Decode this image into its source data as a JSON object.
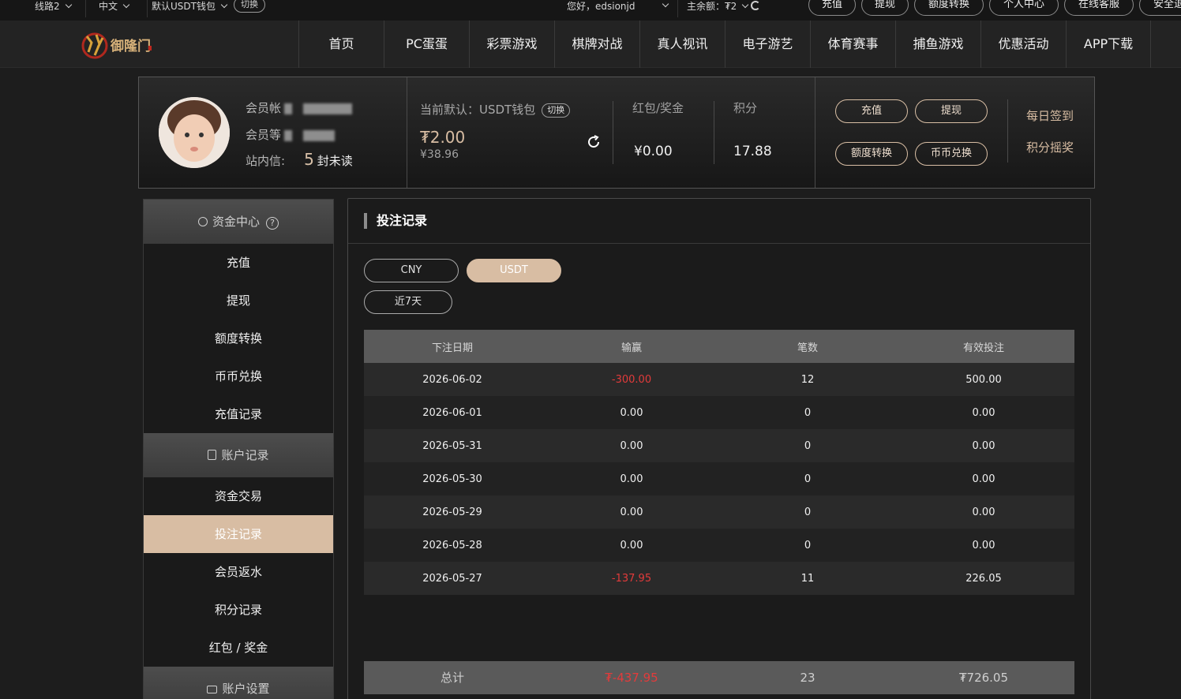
{
  "topbar": {
    "line_select": "线路2",
    "lang_select": "中文",
    "wallet_select": "默认USDT钱包",
    "switch_label": "切换",
    "greeting": "您好，edsionjd",
    "balance_label": "主余额：₮2",
    "buttons": [
      "充值",
      "提现",
      "额度转换",
      "个人中心",
      "在线客服",
      "安全退出"
    ]
  },
  "nav": {
    "items": [
      "首页",
      "PC蛋蛋",
      "彩票游戏",
      "棋牌对战",
      "真人视讯",
      "电子游艺",
      "体育赛事",
      "捕鱼游戏",
      "优惠活动",
      "APP下载"
    ]
  },
  "account": {
    "member_account_label": "会员帐",
    "member_level_label": "会员等",
    "inbox_label": "站内信:",
    "unread_count": "5",
    "unread_label": "封未读",
    "default_wallet": "当前默认：USDT钱包",
    "switch_label": "切换",
    "balance_usdt": "₮2.00",
    "balance_cny": "¥38.96",
    "bonus_label": "红包/奖金",
    "bonus_value": "¥0.00",
    "points_label": "积分",
    "points_value": "17.88",
    "btn_deposit": "充值",
    "btn_withdraw": "提现",
    "btn_transfer": "额度转换",
    "btn_exchange": "币币兑换",
    "daily_signin": "每日签到",
    "points_lottery": "积分摇奖"
  },
  "sidebar": {
    "fund_center": "资金中心",
    "fund_items": [
      "充值",
      "提现",
      "额度转换",
      "币币兑换",
      "充值记录"
    ],
    "account_records": "账户记录",
    "record_items": [
      "资金交易",
      "投注记录",
      "会员返水",
      "积分记录",
      "红包 / 奖金"
    ],
    "account_settings": "账户设置"
  },
  "content": {
    "title": "投注记录",
    "currency_tabs": [
      "CNY",
      "USDT"
    ],
    "range": "近7天",
    "columns": [
      "下注日期",
      "输赢",
      "笔数",
      "有效投注"
    ],
    "rows": [
      [
        "2026-06-02",
        "-300.00",
        "12",
        "500.00"
      ],
      [
        "2026-06-01",
        "0.00",
        "0",
        "0.00"
      ],
      [
        "2026-05-31",
        "0.00",
        "0",
        "0.00"
      ],
      [
        "2026-05-30",
        "0.00",
        "0",
        "0.00"
      ],
      [
        "2026-05-29",
        "0.00",
        "0",
        "0.00"
      ],
      [
        "2026-05-28",
        "0.00",
        "0",
        "0.00"
      ],
      [
        "2026-05-27",
        "-137.95",
        "11",
        "226.05"
      ]
    ],
    "total_label": "总计",
    "total_winloss": "₮-437.95",
    "total_count": "23",
    "total_valid": "₮726.05"
  },
  "colors": {
    "accent": "#d8bda3",
    "negative": "#e23b3b"
  }
}
